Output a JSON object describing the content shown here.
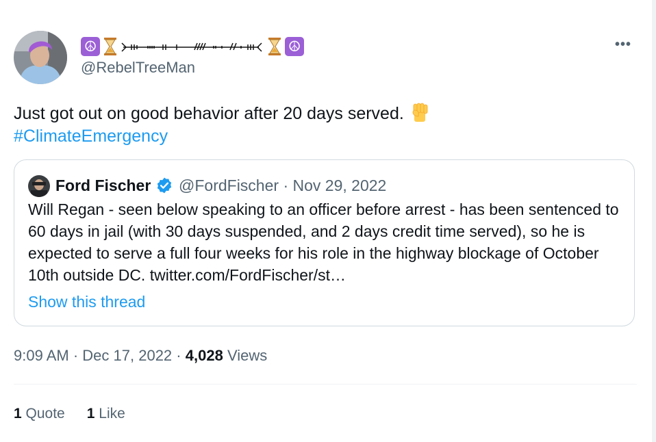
{
  "author": {
    "display_name_icons": [
      "peace-symbol",
      "hourglass",
      "arrow-art",
      "hourglass",
      "peace-symbol"
    ],
    "handle": "@RebelTreeMan"
  },
  "more_icon": "•••",
  "tweet": {
    "text": "Just got out on good behavior after 20 days served.",
    "emoji": "raised-fist",
    "hashtag": "#ClimateEmergency"
  },
  "quoted_tweet": {
    "author_name": "Ford Fischer",
    "verified": true,
    "handle": "@FordFischer",
    "separator": "·",
    "date": "Nov 29, 2022",
    "text": "Will Regan - seen below speaking to an officer before arrest - has been sentenced to 60 days in jail (with 30 days suspended, and 2 days credit time served), so he is expected to serve a full four weeks for his role in the highway blockage of October 10th outside DC. twitter.com/FordFischer/st…",
    "show_thread": "Show this thread"
  },
  "meta": {
    "time": "9:09 AM",
    "separator": "·",
    "date": "Dec 17, 2022",
    "views_count": "4,028",
    "views_label": "Views"
  },
  "stats": {
    "quotes_count": "1",
    "quotes_label": "Quote",
    "likes_count": "1",
    "likes_label": "Like"
  },
  "colors": {
    "link": "#1d9bf0",
    "secondary_text": "#536471",
    "primary_text": "#0f1419",
    "border": "#cfd9de",
    "peace_bg": "#9b5fd6"
  }
}
